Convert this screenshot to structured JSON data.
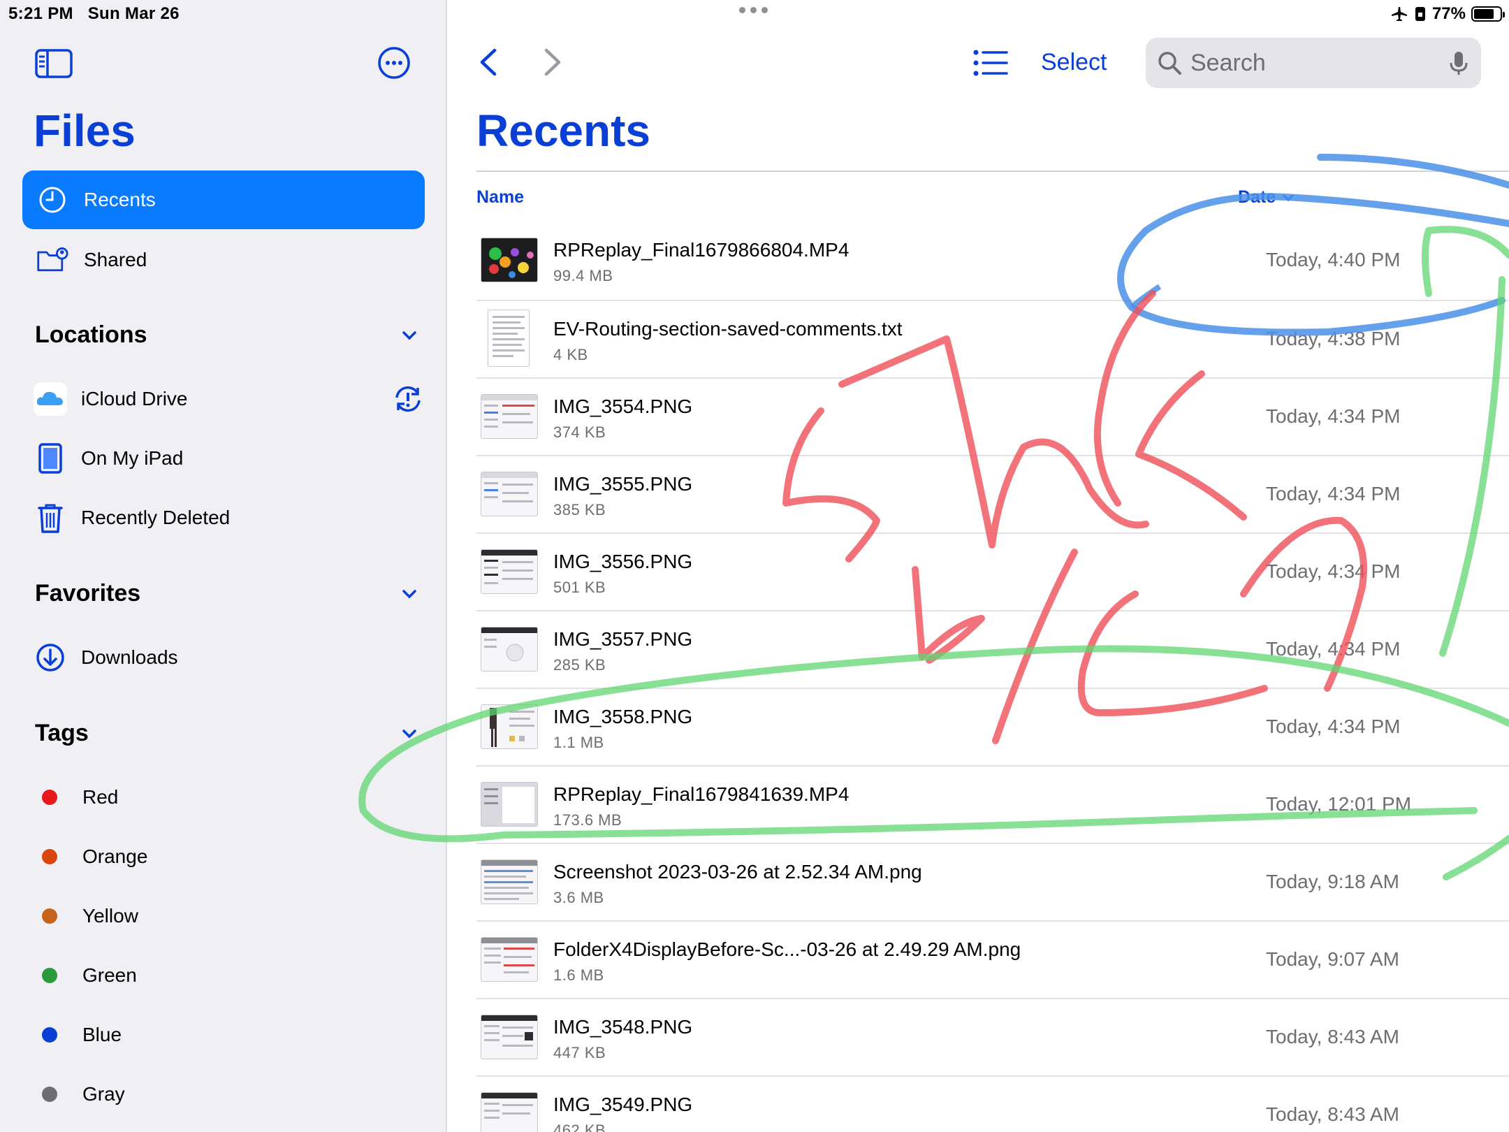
{
  "status_bar": {
    "time": "5:21 PM",
    "date": "Sun Mar 26",
    "battery": "77%",
    "battery_level": 0.77
  },
  "sidebar": {
    "title": "Files",
    "nav": [
      {
        "label": "Recents",
        "active": true
      },
      {
        "label": "Shared",
        "active": false
      }
    ],
    "locations": {
      "header": "Locations",
      "items": [
        "iCloud Drive",
        "On My iPad",
        "Recently Deleted"
      ]
    },
    "favorites": {
      "header": "Favorites",
      "items": [
        "Downloads"
      ]
    },
    "tags": {
      "header": "Tags",
      "items": [
        {
          "label": "Red",
          "color": "#e8191b"
        },
        {
          "label": "Orange",
          "color": "#d9470f"
        },
        {
          "label": "Yellow",
          "color": "#c8631a"
        },
        {
          "label": "Green",
          "color": "#2a9a3c"
        },
        {
          "label": "Blue",
          "color": "#0a3fd6"
        },
        {
          "label": "Gray",
          "color": "#6d6d72"
        }
      ]
    }
  },
  "toolbar": {
    "select_label": "Select",
    "search_placeholder": "Search"
  },
  "main": {
    "title": "Recents",
    "columns": {
      "name": "Name",
      "date": "Date"
    },
    "files": [
      {
        "name": "RPReplay_Final1679866804.MP4",
        "size": "99.4 MB",
        "date": "Today, 4:40 PM",
        "kind": "video"
      },
      {
        "name": "EV-Routing-section-saved-comments.txt",
        "size": "4 KB",
        "date": "Today, 4:38 PM",
        "kind": "doc"
      },
      {
        "name": "IMG_3554.PNG",
        "size": "374 KB",
        "date": "Today, 4:34 PM",
        "kind": "image"
      },
      {
        "name": "IMG_3555.PNG",
        "size": "385 KB",
        "date": "Today, 4:34 PM",
        "kind": "image"
      },
      {
        "name": "IMG_3556.PNG",
        "size": "501 KB",
        "date": "Today, 4:34 PM",
        "kind": "image"
      },
      {
        "name": "IMG_3557.PNG",
        "size": "285 KB",
        "date": "Today, 4:34 PM",
        "kind": "image"
      },
      {
        "name": "IMG_3558.PNG",
        "size": "1.1 MB",
        "date": "Today, 4:34 PM",
        "kind": "image"
      },
      {
        "name": "RPReplay_Final1679841639.MP4",
        "size": "173.6 MB",
        "date": "Today, 12:01 PM",
        "kind": "video-light"
      },
      {
        "name": "Screenshot 2023-03-26 at 2.52.34 AM.png",
        "size": "3.6 MB",
        "date": "Today, 9:18 AM",
        "kind": "image"
      },
      {
        "name": "FolderX4DisplayBefore-Sc...-03-26 at 2.49.29 AM.png",
        "size": "1.6 MB",
        "date": "Today, 9:07 AM",
        "kind": "image"
      },
      {
        "name": "IMG_3548.PNG",
        "size": "447 KB",
        "date": "Today, 8:43 AM",
        "kind": "image"
      },
      {
        "name": "IMG_3549.PNG",
        "size": "462 KB",
        "date": "Today, 8:43 AM",
        "kind": "image"
      }
    ]
  },
  "colors": {
    "accent": "#0a3fd6",
    "active_bg": "#0a7aff",
    "sidebar_bg": "#efeff4"
  }
}
